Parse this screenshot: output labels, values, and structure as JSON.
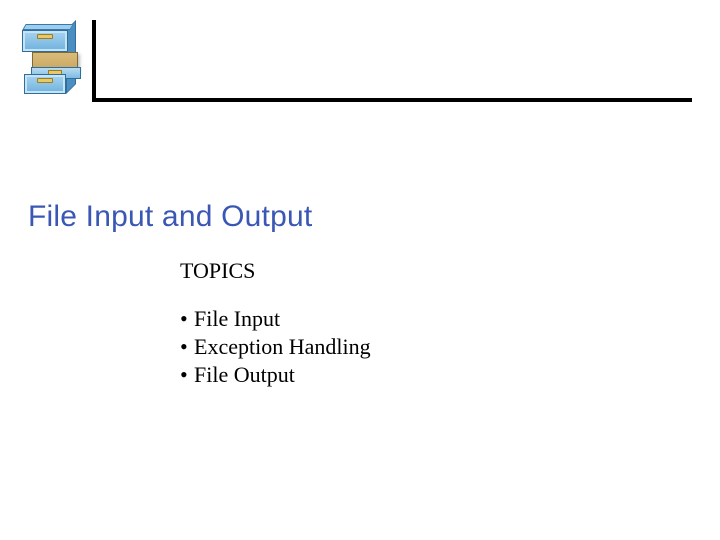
{
  "title": "File Input and Output",
  "topics_label": "TOPICS",
  "bullet_char": "•",
  "bullets": {
    "0": "File Input",
    "1": "Exception Handling",
    "2": "File Output"
  }
}
